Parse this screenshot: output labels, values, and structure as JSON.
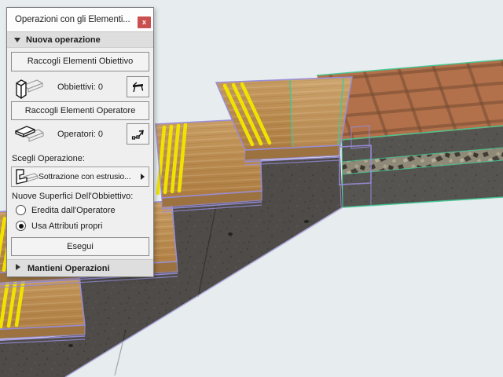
{
  "window": {
    "title": "Operazioni con gli Elementi...",
    "close": "x"
  },
  "panel": {
    "section_new": "Nuova operazione",
    "section_keep": "Mantieni Operazioni",
    "collect_targets": "Raccogli Elementi Obiettivo",
    "targets_count": "Obbiettivi: 0",
    "collect_operators": "Raccogli Elementi Operatore",
    "operators_count": "Operatori: 0",
    "choose_operation_label": "Scegli Operazione:",
    "operation_value": "Sottrazione con estrusio...",
    "new_surfaces_label": "Nuove Superfici Dell'Obbiettivo:",
    "radio_inherit": "Eredita dall'Operatore",
    "radio_own": "Usa Attributi propri",
    "radio_selected": "Usa Attributi propri",
    "execute": "Esegui"
  },
  "icons": {
    "close": "close-icon",
    "target_elements": "target-elements-icon",
    "pick_targets": "pick-targets-icon",
    "operator_elements": "operator-elements-icon",
    "pick_operators": "pick-operators-icon",
    "operation_type": "operation-type-icon"
  },
  "colors": {
    "bg3d": "#e7ecef",
    "concrete": "#4e4b48",
    "slab_face": "#565450",
    "gravel": "#8f8977",
    "tile": "#b2714a",
    "grout": "#6f4730",
    "wood_front": "#9c7340",
    "strip_yellow": "#efe400",
    "selection_purple": "#978cd8",
    "highlight_teal": "#43c795",
    "dialog_bg": "#efefef",
    "titlebar_bg": "#fdfdfd",
    "header_bg": "#dedede",
    "button_bg": "#f3f3f3",
    "close_red": "#c9504e",
    "text": "#1c1c1c"
  }
}
